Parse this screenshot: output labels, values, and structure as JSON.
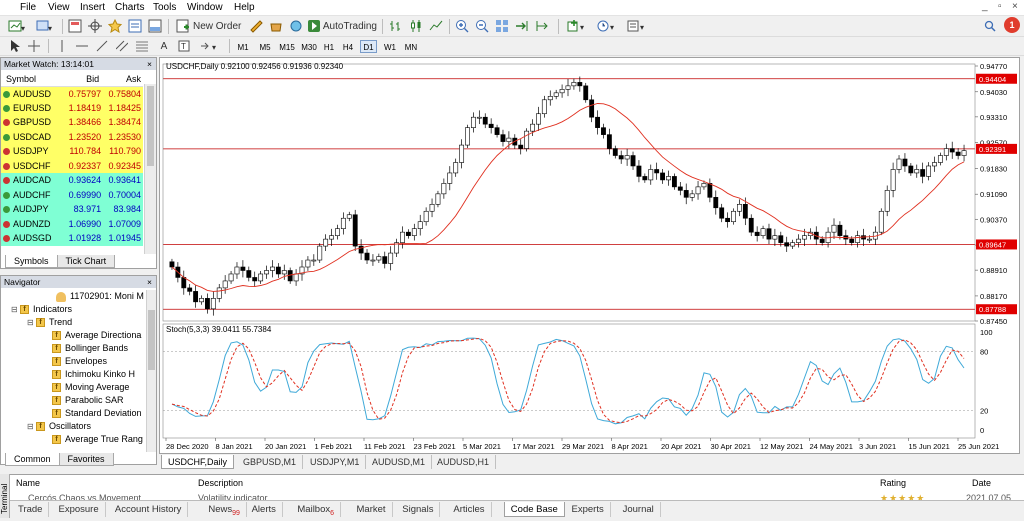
{
  "menu": {
    "items": [
      "File",
      "View",
      "Insert",
      "Charts",
      "Tools",
      "Window",
      "Help"
    ],
    "window_controls": [
      "_",
      "▫",
      "×"
    ]
  },
  "toolbar": {
    "new_order": "New Order",
    "autotrading": "AutoTrading",
    "notification_count": "1"
  },
  "timeframes": [
    "M1",
    "M5",
    "M15",
    "M30",
    "H1",
    "H4",
    "D1",
    "W1",
    "MN"
  ],
  "selected_timeframe": "D1",
  "market_watch": {
    "title": "Market Watch: 13:14:01",
    "columns": [
      "Symbol",
      "Bid",
      "Ask"
    ],
    "rows": [
      {
        "symbol": "AUDUSD",
        "bid": "0.75797",
        "ask": "0.75804",
        "dir": "up",
        "bg": "#ffff66"
      },
      {
        "symbol": "EURUSD",
        "bid": "1.18419",
        "ask": "1.18425",
        "dir": "up",
        "bg": "#ffff66"
      },
      {
        "symbol": "GBPUSD",
        "bid": "1.38466",
        "ask": "1.38474",
        "dir": "dn",
        "bg": "#ffff66"
      },
      {
        "symbol": "USDCAD",
        "bid": "1.23520",
        "ask": "1.23530",
        "dir": "up",
        "bg": "#ffff66"
      },
      {
        "symbol": "USDJPY",
        "bid": "110.784",
        "ask": "110.790",
        "dir": "dn",
        "bg": "#ffff66"
      },
      {
        "symbol": "USDCHF",
        "bid": "0.92337",
        "ask": "0.92345",
        "dir": "dn",
        "bg": "#ffff66"
      },
      {
        "symbol": "AUDCAD",
        "bid": "0.93624",
        "ask": "0.93641",
        "dir": "dn",
        "bg": "#7fffd4"
      },
      {
        "symbol": "AUDCHF",
        "bid": "0.69990",
        "ask": "0.70004",
        "dir": "up",
        "bg": "#7fffd4"
      },
      {
        "symbol": "AUDJPY",
        "bid": "83.971",
        "ask": "83.984",
        "dir": "up",
        "bg": "#7fffd4"
      },
      {
        "symbol": "AUDNZD",
        "bid": "1.06990",
        "ask": "1.07009",
        "dir": "dn",
        "bg": "#7fffd4"
      },
      {
        "symbol": "AUDSGD",
        "bid": "1.01928",
        "ask": "1.01945",
        "dir": "dn",
        "bg": "#7fffd4"
      }
    ],
    "tabs": [
      "Symbols",
      "Tick Chart"
    ]
  },
  "navigator": {
    "title": "Navigator",
    "account": "11702901: Moni M",
    "items": [
      {
        "label": "Indicators",
        "level": 0,
        "toggle": "⊟"
      },
      {
        "label": "Trend",
        "level": 1,
        "toggle": "⊟"
      },
      {
        "label": "Average Directiona",
        "level": 2,
        "toggle": ""
      },
      {
        "label": "Bollinger Bands",
        "level": 2,
        "toggle": ""
      },
      {
        "label": "Envelopes",
        "level": 2,
        "toggle": ""
      },
      {
        "label": "Ichimoku Kinko H",
        "level": 2,
        "toggle": ""
      },
      {
        "label": "Moving Average",
        "level": 2,
        "toggle": ""
      },
      {
        "label": "Parabolic SAR",
        "level": 2,
        "toggle": ""
      },
      {
        "label": "Standard Deviation",
        "level": 2,
        "toggle": ""
      },
      {
        "label": "Oscillators",
        "level": 1,
        "toggle": "⊟"
      },
      {
        "label": "Average True Rang",
        "level": 2,
        "toggle": ""
      }
    ],
    "tabs": [
      "Common",
      "Favorites"
    ]
  },
  "chart": {
    "info": "USDCHF,Daily  0.92100 0.92456 0.91936 0.92340",
    "stoch_label": "Stoch(5,3,3) 39.0411 55.7384",
    "hlines": [
      {
        "price": 0.94404,
        "label": "0.94404"
      },
      {
        "price": 0.92391,
        "label": "0.92391"
      },
      {
        "price": 0.89647,
        "label": "0.89647"
      },
      {
        "price": 0.87788,
        "label": "0.87788"
      }
    ],
    "colors": {
      "hline": "#c00000",
      "ma": "#e03020",
      "stoch_main": "#3fa9d8",
      "stoch_signal": "#e03020",
      "hlabel_bg": "#e00000"
    }
  },
  "chart_data": {
    "type": "candlestick",
    "symbol": "USDCHF",
    "timeframe": "Daily",
    "y_ticks": [
      "0.94770",
      "0.94030",
      "0.93310",
      "0.92570",
      "0.91830",
      "0.91090",
      "0.90370",
      "0.89630",
      "0.88910",
      "0.88170",
      "0.87450"
    ],
    "ylim": [
      0.8745,
      0.9477
    ],
    "x_labels": [
      "28 Dec 2020",
      "8 Jan 2021",
      "20 Jan 2021",
      "1 Feb 2021",
      "11 Feb 2021",
      "23 Feb 2021",
      "5 Mar 2021",
      "17 Mar 2021",
      "29 Mar 2021",
      "8 Apr 2021",
      "20 Apr 2021",
      "30 Apr 2021",
      "12 May 2021",
      "24 May 2021",
      "3 Jun 2021",
      "15 Jun 2021",
      "25 Jun 2021"
    ],
    "closes": [
      0.89,
      0.887,
      0.884,
      0.883,
      0.88,
      0.881,
      0.878,
      0.881,
      0.884,
      0.886,
      0.888,
      0.89,
      0.889,
      0.887,
      0.886,
      0.888,
      0.889,
      0.89,
      0.888,
      0.889,
      0.886,
      0.888,
      0.89,
      0.892,
      0.892,
      0.896,
      0.898,
      0.899,
      0.901,
      0.904,
      0.905,
      0.896,
      0.894,
      0.892,
      0.892,
      0.893,
      0.891,
      0.894,
      0.897,
      0.9,
      0.899,
      0.901,
      0.903,
      0.906,
      0.908,
      0.911,
      0.914,
      0.917,
      0.92,
      0.925,
      0.93,
      0.933,
      0.933,
      0.931,
      0.93,
      0.928,
      0.926,
      0.927,
      0.925,
      0.924,
      0.929,
      0.931,
      0.934,
      0.938,
      0.939,
      0.94,
      0.941,
      0.942,
      0.943,
      0.942,
      0.938,
      0.933,
      0.93,
      0.928,
      0.924,
      0.922,
      0.921,
      0.922,
      0.919,
      0.916,
      0.915,
      0.918,
      0.917,
      0.915,
      0.916,
      0.913,
      0.912,
      0.91,
      0.911,
      0.913,
      0.914,
      0.91,
      0.907,
      0.904,
      0.903,
      0.906,
      0.908,
      0.904,
      0.9,
      0.899,
      0.901,
      0.898,
      0.899,
      0.897,
      0.896,
      0.897,
      0.898,
      0.899,
      0.9,
      0.898,
      0.897,
      0.9,
      0.902,
      0.899,
      0.898,
      0.897,
      0.899,
      0.898,
      0.898,
      0.9,
      0.906,
      0.912,
      0.918,
      0.921,
      0.919,
      0.917,
      0.918,
      0.916,
      0.919,
      0.92,
      0.922,
      0.924,
      0.923,
      0.922,
      0.9234
    ]
  },
  "chart_tabs": [
    "USDCHF,Daily",
    "GBPUSD,M1",
    "USDJPY,M1",
    "AUDUSD,M1",
    "AUDUSD,H1"
  ],
  "terminal": {
    "columns": [
      "Name",
      "Description",
      "Rating",
      "Date"
    ],
    "row": {
      "name": "Cercós Chaos vs Movement",
      "description": "Volatility indicator",
      "date": "2021.07.05"
    },
    "tabs": [
      {
        "label": "Trade",
        "badge": ""
      },
      {
        "label": "Exposure",
        "badge": ""
      },
      {
        "label": "Account History",
        "badge": ""
      },
      {
        "label": "News",
        "badge": "99"
      },
      {
        "label": "Alerts",
        "badge": ""
      },
      {
        "label": "Mailbox",
        "badge": "6"
      },
      {
        "label": "Market",
        "badge": ""
      },
      {
        "label": "Signals",
        "badge": ""
      },
      {
        "label": "Articles",
        "badge": ""
      },
      {
        "label": "Code Base",
        "badge": ""
      },
      {
        "label": "Experts",
        "badge": ""
      },
      {
        "label": "Journal",
        "badge": ""
      }
    ],
    "active_tab": "Code Base",
    "side_label": "Terminal"
  }
}
